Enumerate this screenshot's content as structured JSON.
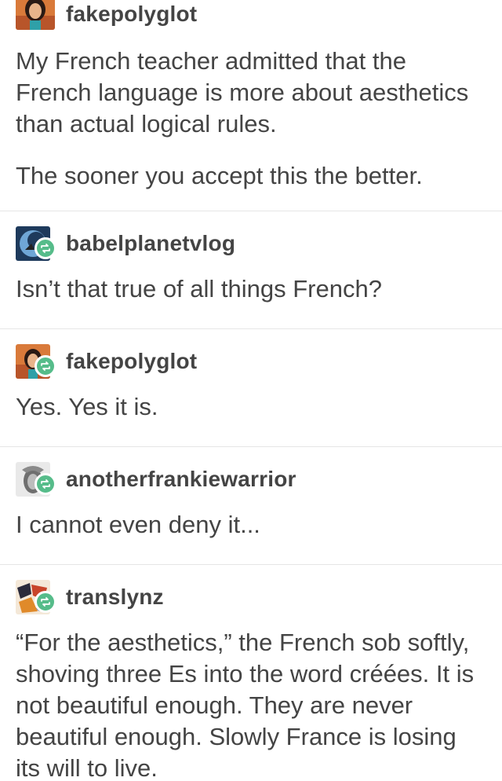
{
  "posts": [
    {
      "username": "fakepolyglot",
      "avatar_icon": "avatar-fakepolyglot-icon",
      "reblog": false,
      "paragraphs": [
        "My French teacher admitted that the French language is more about aesthetics than actual logical rules.",
        "The sooner you accept this the better."
      ]
    },
    {
      "username": "babelplanetvlog",
      "avatar_icon": "avatar-babelplanetvlog-icon",
      "reblog": true,
      "paragraphs": [
        "Isn’t that true of all things French?"
      ]
    },
    {
      "username": "fakepolyglot",
      "avatar_icon": "avatar-fakepolyglot-icon",
      "reblog": true,
      "paragraphs": [
        "Yes. Yes it is."
      ]
    },
    {
      "username": "anotherfrankiewarrior",
      "avatar_icon": "avatar-anotherfrankiewarrior-icon",
      "reblog": true,
      "paragraphs": [
        "I cannot even deny it..."
      ]
    },
    {
      "username": "translynz",
      "avatar_icon": "avatar-translynz-icon",
      "reblog": true,
      "paragraphs": [
        "“For the aesthetics,” the French sob softly, shoving three Es into the word créées. It is not beautiful enough. They are never beautiful enough. Slowly France is losing its will to live."
      ]
    }
  ],
  "colors": {
    "text": "#444444",
    "reblog_badge": "#56bc8a",
    "divider": "#e6e6e6"
  }
}
